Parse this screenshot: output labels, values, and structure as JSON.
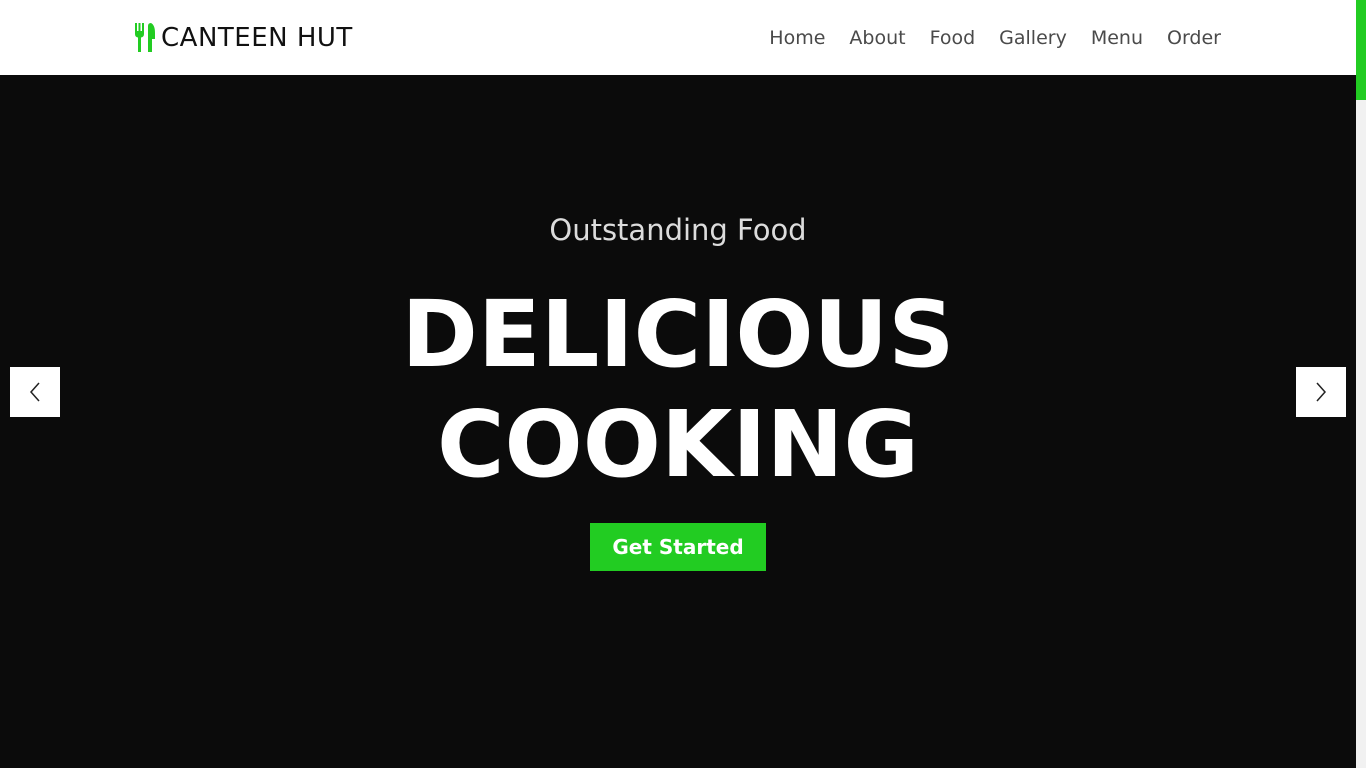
{
  "brand": {
    "name": "CANTEEN HUT",
    "icon": "fork-knife-icon",
    "accent_color": "#22cc22"
  },
  "nav": {
    "items": [
      "Home",
      "About",
      "Food",
      "Gallery",
      "Menu",
      "Order"
    ]
  },
  "hero": {
    "subtitle": "Outstanding Food",
    "title_line1": "DELICIOUS",
    "title_line2": "COOKING",
    "cta_label": "Get Started",
    "background_color": "#0b0b0b"
  },
  "carousel": {
    "prev_icon": "chevron-left-icon",
    "next_icon": "chevron-right-icon"
  }
}
